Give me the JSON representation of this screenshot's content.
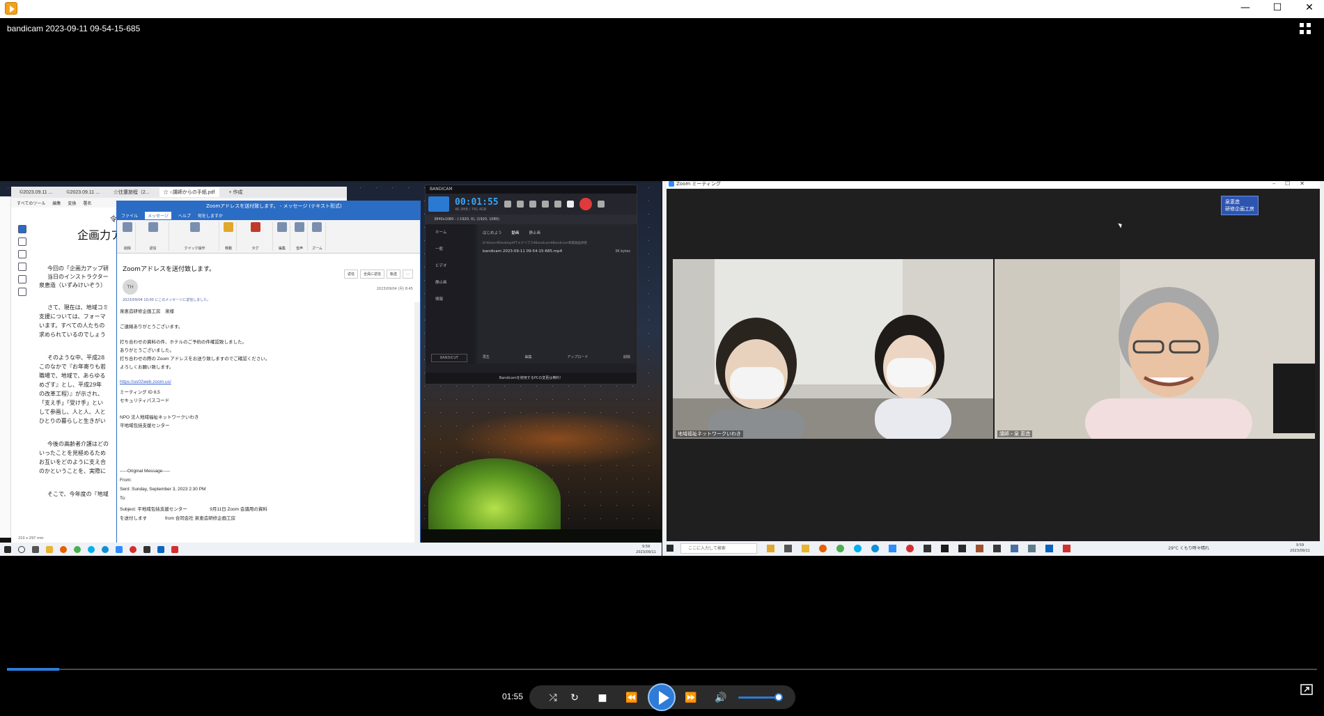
{
  "window": {
    "min_glyph": "—",
    "max_glyph": "☐",
    "close_glyph": "✕"
  },
  "player": {
    "file_title": "bandicam 2023-09-11 09-54-15-685",
    "current_time": "01:55",
    "progress_fraction": 0.04,
    "volume_fraction": 0.9
  },
  "pdf": {
    "tabs": [
      "©2023.09.11 ...",
      "©2023.09.11 ...",
      "☆往還旅程（2...",
      "☆ ○講師からの手紙.pdf",
      "+ 作成"
    ],
    "menu": [
      "すべてのツール",
      "編集",
      "変換",
      "署名"
    ],
    "heading_top": "令和",
    "heading": "企画力アッ",
    "lines": [
      "今回の「企画力アップ研",
      "当日のインストラクター",
      "泉恵造（いずみけいぞう）",
      "さて、現在は、地域コミ",
      "支援については、フォーマ",
      "います。すべての人たちの",
      "求められているのでしょう",
      "そのような中、平成28",
      "このなかで『お年寄りも若",
      "職場で、地域で、あらゆる",
      "めざす』とし、平成29年",
      "の改革工程）』が示され、",
      "「支え手」「受け手」とい",
      "して参画し、人と人、人と",
      "ひとりの暮らしと生きがい",
      "今後の高齢者介護はどの",
      "いったことを見極めるため",
      "お互いをどのように支え合",
      "のかということを、実際に",
      "そこで、今年度の『地域"
    ],
    "footer": "210 x 297 mm"
  },
  "outlook": {
    "title": "Zoomアドレスを送付致します。 - メッセージ (テキスト形式)",
    "tabs": [
      "ファイル",
      "メッセージ",
      "ヘルプ",
      "何をしますか"
    ],
    "ribbon_groups": [
      "削除",
      "返信",
      "クイック操作",
      "移動",
      "タグ",
      "編集",
      "音声",
      "ズーム"
    ],
    "subject": "Zoomアドレスを送付致します。",
    "actions": [
      "返信",
      "全員に返信",
      "転送",
      "…"
    ],
    "avatar": "TH",
    "date": "2023/09/04 (月) 8:45",
    "reply_note": "2023/09/04 10:00 にこのメッセージに返信しました。",
    "body": [
      "泉恵造研修企画工房　泉様",
      "",
      "ご連絡ありがとうございます。",
      "",
      "打ち合わせの資料の件、ホテルのご予約の件確認致しました。",
      "ありがとうございました。",
      "打ち合わせの際の Zoom アドレスをお送り致しますのでご確認ください。",
      "よろしくお願い致します。",
      "",
      "https://us02web.zoom.us/",
      "ミーティング ID 8,5",
      "セキュリティパスコード",
      "",
      "NPO 法人地域福祉ネットワークいわき",
      "平地域包括支援センター",
      "",
      "",
      "",
      "-----Original Message-----",
      "From:",
      "Sent: Sunday, September 3, 2023 2:30 PM",
      "To:",
      "Subject: 平地域包括支援センター　　　　　9月11日 Zoom 会議用の資料",
      "を送付します　　　　from 合同会社 泉恵造研修企画工房"
    ]
  },
  "bandicam": {
    "brand": "BANDICAM",
    "rec_time": "00:01:55",
    "rec_size": "46.3MB / 791.4GB",
    "resolution": "3840x1080 - (-1920, 0), (1920, 1080)",
    "sidebar": [
      "ホーム",
      "一般",
      "ビデオ",
      "静止画",
      "情報"
    ],
    "tabs": [
      "はじめよう",
      "動画",
      "静止画"
    ],
    "path": "D:¥Users¥Desktop¥FTエクリプス¥Bandicam¥Bandicam専属録画保管",
    "file": "bandicam 2023-09-11 09-54-15-685.mp4",
    "file_size": "3K bytes",
    "buttons": [
      "再生",
      "編集",
      "アップロード",
      "削除"
    ],
    "cut_label": "BANDICUT",
    "footer": "Bandicamを使用するPCの変更は無料！"
  },
  "zoom": {
    "title": "Zoom ミーティング",
    "speaker_badge": [
      "泉恵造",
      "研修企画工房"
    ],
    "tiles": [
      {
        "label": "地域福祉ネットワークいわき"
      },
      {
        "label": "講師・泉 恵造"
      }
    ]
  },
  "taskbar": {
    "search_placeholder": "ここに入力して検索",
    "weather": "29°C くもり時々晴れ",
    "clock_time": "9:59",
    "clock_date": "2023/09/11",
    "left_clock_time": "9:59",
    "left_clock_date": "2023/09/11"
  },
  "colors": {
    "accent": "#2e7bd8",
    "outlook_blue": "#2b6cc4",
    "bandicam_blue": "#38a6f5",
    "record_red": "#e03a3a"
  }
}
